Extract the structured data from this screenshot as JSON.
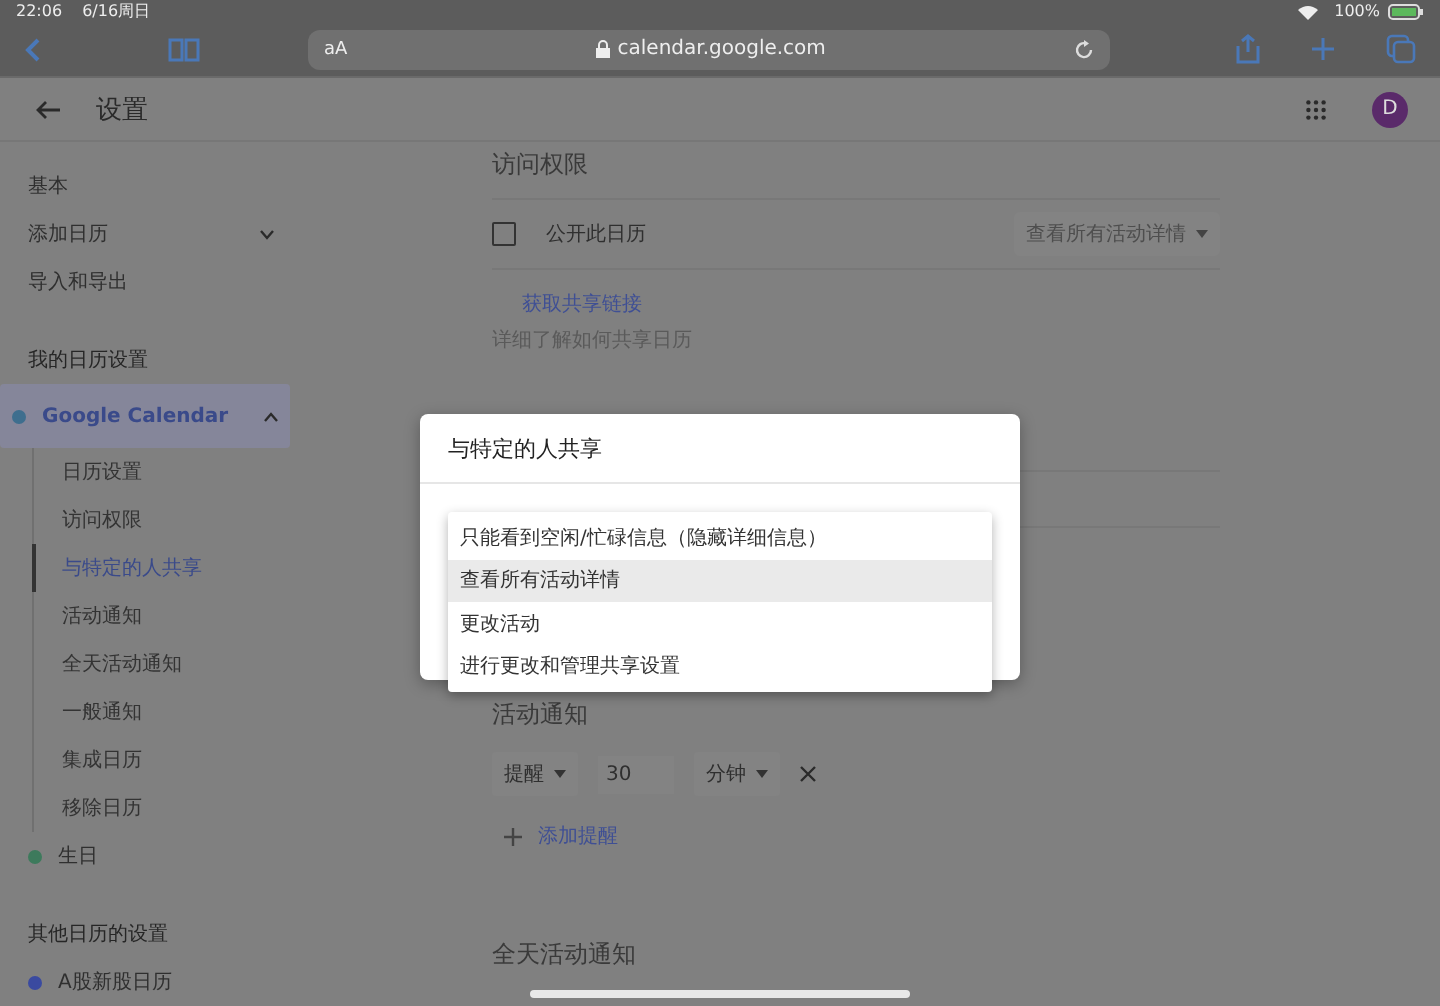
{
  "status_bar": {
    "time": "22:06",
    "date": "6/16周日",
    "battery": "100%"
  },
  "browser": {
    "text_size": "aA",
    "url": "calendar.google.com"
  },
  "header": {
    "title": "设置",
    "avatar": "D"
  },
  "sidebar": {
    "items": [
      {
        "kind": "item",
        "label": "基本",
        "selected": false
      },
      {
        "kind": "item",
        "label": "添加日历",
        "selected": false,
        "expanded": false
      },
      {
        "kind": "item",
        "label": "导入和导出",
        "selected": false
      },
      {
        "kind": "heading",
        "label": "我的日历设置"
      },
      {
        "kind": "calendar",
        "label": "Google Calendar",
        "color": "#3e6e8e",
        "selected": true,
        "expanded": true,
        "children": [
          {
            "label": "日历设置",
            "selected": false
          },
          {
            "label": "访问权限",
            "selected": false
          },
          {
            "label": "与特定的人共享",
            "selected": true
          },
          {
            "label": "活动通知",
            "selected": false
          },
          {
            "label": "全天活动通知",
            "selected": false
          },
          {
            "label": "一般通知",
            "selected": false
          },
          {
            "label": "集成日历",
            "selected": false
          },
          {
            "label": "移除日历",
            "selected": false
          }
        ]
      },
      {
        "kind": "calendar",
        "label": "生日",
        "color": "#3d7a5c",
        "selected": false
      },
      {
        "kind": "heading",
        "label": "其他日历的设置"
      },
      {
        "kind": "calendar",
        "label": "A股新股日历",
        "color": "#3a4aa0",
        "selected": false
      }
    ]
  },
  "access": {
    "title": "访问权限",
    "public": {
      "label": "公开此日历",
      "checked": false,
      "permission": "查看所有活动详情",
      "disabled": true
    },
    "link": "获取共享链接",
    "help": "详细了解如何共享日历"
  },
  "notifications": {
    "title": "活动通知",
    "rows": [
      {
        "type": "提醒",
        "value": "30",
        "unit": "分钟"
      }
    ],
    "add": "添加提醒"
  },
  "all_day": {
    "title": "全天活动通知"
  },
  "dialog": {
    "title": "与特定的人共享",
    "options": [
      {
        "label": "只能看到空闲/忙碌信息（隐藏详细信息）",
        "selected": false
      },
      {
        "label": "查看所有活动详情",
        "selected": true
      },
      {
        "label": "更改活动",
        "selected": false
      },
      {
        "label": "进行更改和管理共享设置",
        "selected": false
      }
    ]
  }
}
